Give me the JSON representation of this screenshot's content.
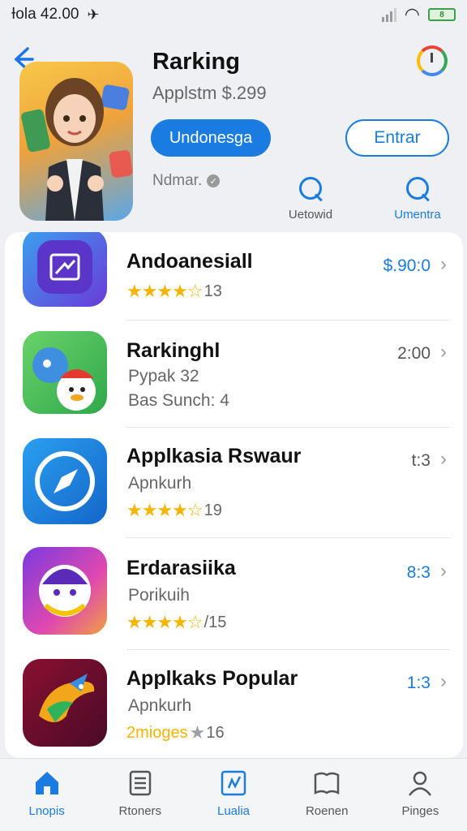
{
  "status_bar": {
    "time": "Ɨola 42.00",
    "battery": "8"
  },
  "header": {
    "title": "Rarking",
    "subtitle": "Applstm $.299",
    "primary_button": "Undonesga",
    "secondary_button": "Entrar",
    "developer": "Ndmar.",
    "actions": [
      {
        "label": "Uetowid"
      },
      {
        "label": "Umentra"
      }
    ]
  },
  "apps": [
    {
      "name": "Andoanesiall",
      "line2": "",
      "rating_text": "13",
      "stars": 3.5,
      "price": "$.90:0",
      "price_color": "#1a7ce0"
    },
    {
      "name": "Rarkinghl",
      "line2": "Pypak 32",
      "line3": "Bas Sunch: 4",
      "price": "2:00",
      "price_color": "#555555"
    },
    {
      "name": "Applkasia Rswaur",
      "line2": "Apnkurh",
      "rating_text": "19",
      "stars": 3.5,
      "price": "t:3",
      "price_color": "#555555"
    },
    {
      "name": "Erdarasiika",
      "line2": "Porikuih",
      "rating_text": "/15",
      "stars": 3.5,
      "price": "8:3",
      "price_color": "#1a7ce0"
    },
    {
      "name": "Applkaks Popular",
      "line2": "Apnkurh",
      "rating_prefix": "2mioges",
      "rating_text": "16",
      "price": "1:3",
      "price_color": "#1a7ce0"
    }
  ],
  "tabs": [
    {
      "label": "Lnopis",
      "icon": "home-icon",
      "active": true
    },
    {
      "label": "Rtoners",
      "icon": "document-icon",
      "active": false
    },
    {
      "label": "Lualia",
      "icon": "calendar-icon",
      "active": true
    },
    {
      "label": "Roenen",
      "icon": "book-icon",
      "active": false
    },
    {
      "label": "Pinges",
      "icon": "person-icon",
      "active": false
    }
  ]
}
